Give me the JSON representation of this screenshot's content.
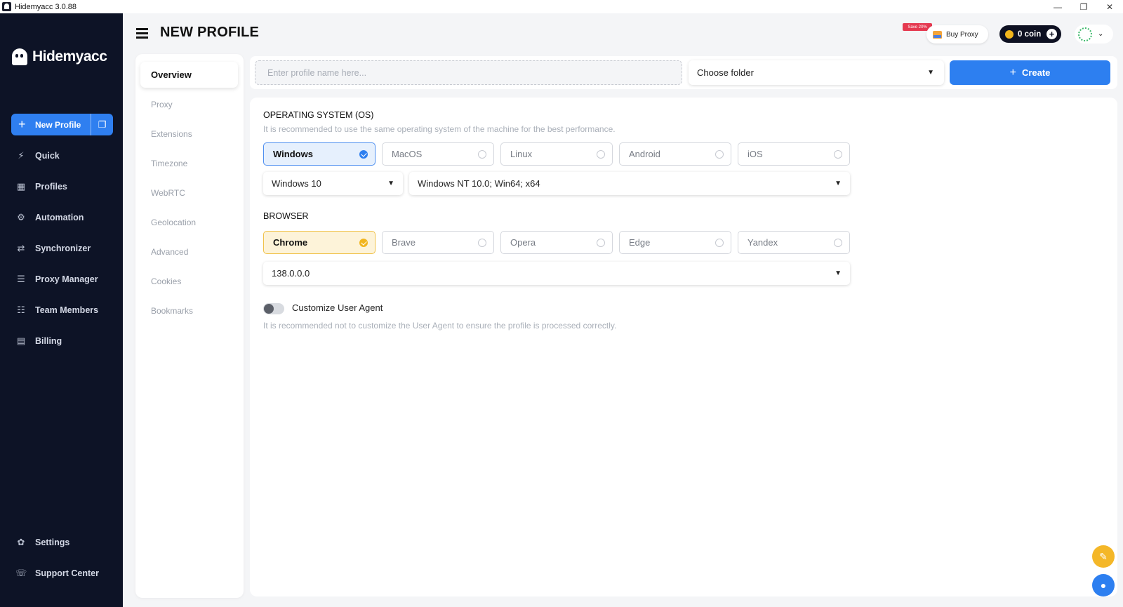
{
  "window": {
    "title": "Hidemyacc 3.0.88",
    "controls": [
      "—",
      "❐",
      "✕"
    ]
  },
  "sidebar": {
    "brand": "Hidemyacc",
    "new_profile_label": "New Profile",
    "items": [
      {
        "label": "Quick",
        "icon": "bolt-icon"
      },
      {
        "label": "Profiles",
        "icon": "grid-icon"
      },
      {
        "label": "Automation",
        "icon": "robot-icon"
      },
      {
        "label": "Synchronizer",
        "icon": "sync-icon"
      },
      {
        "label": "Proxy Manager",
        "icon": "server-icon"
      },
      {
        "label": "Team Members",
        "icon": "team-icon"
      },
      {
        "label": "Billing",
        "icon": "receipt-icon"
      }
    ],
    "bottom_items": [
      {
        "label": "Settings",
        "icon": "gear-icon"
      },
      {
        "label": "Support Center",
        "icon": "support-icon"
      }
    ]
  },
  "header": {
    "title": "NEW PROFILE",
    "save_badge": "Save 20%",
    "buy_proxy": "Buy Proxy",
    "coins": "0 coin"
  },
  "subnav": [
    "Overview",
    "Proxy",
    "Extensions",
    "Timezone",
    "WebRTC",
    "Geolocation",
    "Advanced",
    "Cookies",
    "Bookmarks"
  ],
  "form": {
    "profile_name_placeholder": "Enter profile name here...",
    "folder_label": "Choose folder",
    "create_label": "Create"
  },
  "os": {
    "title": "OPERATING SYSTEM (OS)",
    "subtitle": "It is recommended to use the same operating system of the machine for the best performance.",
    "options": [
      "Windows",
      "MacOS",
      "Linux",
      "Android",
      "iOS"
    ],
    "selected": "Windows",
    "version": "Windows 10",
    "platform": "Windows NT 10.0; Win64; x64"
  },
  "browser": {
    "title": "BROWSER",
    "options": [
      "Chrome",
      "Brave",
      "Opera",
      "Edge",
      "Yandex"
    ],
    "selected": "Chrome",
    "version": "138.0.0.0"
  },
  "user_agent": {
    "label": "Customize User Agent",
    "note": "It is recommended not to customize the User Agent to ensure the profile is processed correctly.",
    "enabled": false
  },
  "colors": {
    "sidebar_bg": "#0d1326",
    "primary": "#2d7ff0",
    "accent_yellow": "#f1b51f"
  }
}
